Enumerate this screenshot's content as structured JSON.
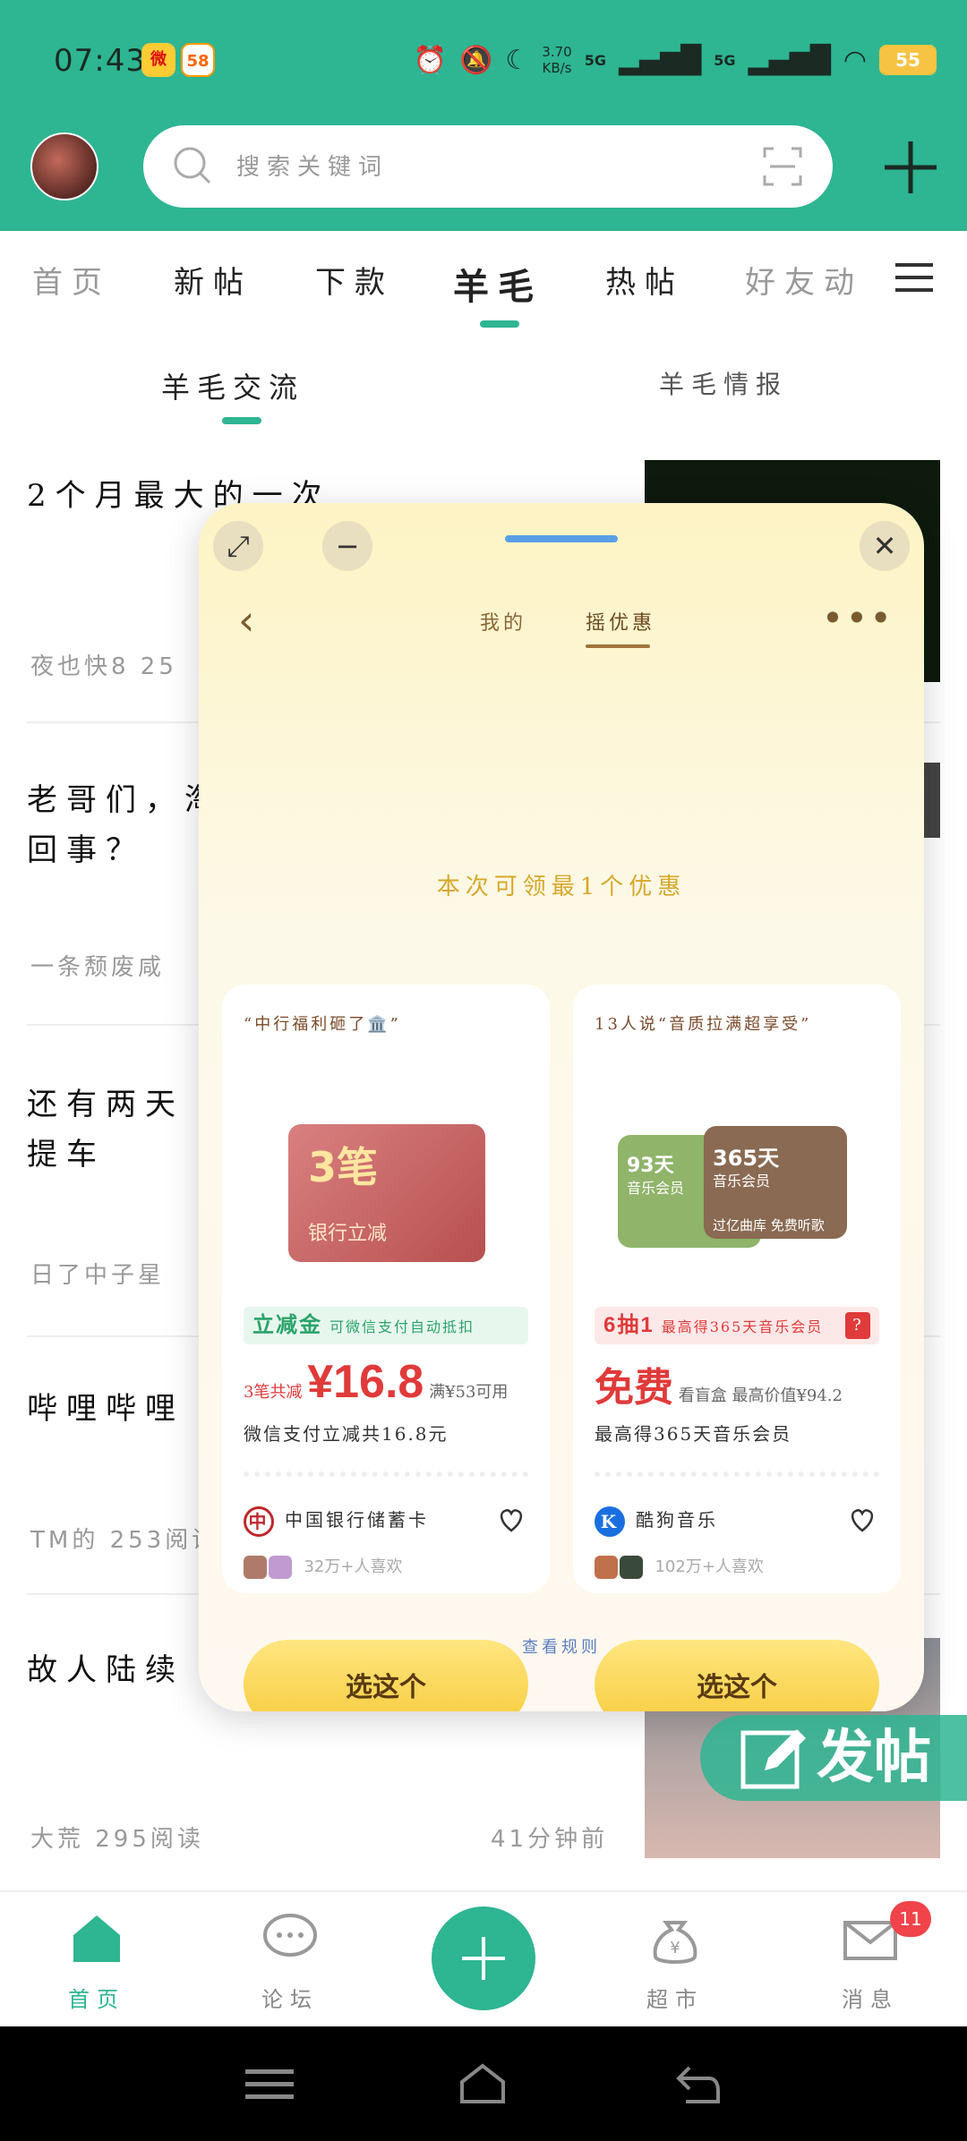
{
  "status": {
    "time": "07:43",
    "apps": [
      "微",
      "58"
    ],
    "speed": "3.70\nKB/s",
    "signal1": "5G",
    "signal2": "5G",
    "battery": "55"
  },
  "header": {
    "search_placeholder": "搜索关键词"
  },
  "nav_tabs": [
    {
      "label": "首页",
      "dim": true
    },
    {
      "label": "新帖"
    },
    {
      "label": "下款"
    },
    {
      "label": "羊毛",
      "active": true
    },
    {
      "label": "热帖"
    },
    {
      "label": "好友动"
    }
  ],
  "sub_tabs": [
    {
      "label": "羊毛交流",
      "active": true
    },
    {
      "label": "羊毛情报"
    }
  ],
  "feed": [
    {
      "title": "2个月最大的一次",
      "meta": "夜也快8   25"
    },
    {
      "title": "老哥们，淘",
      "title2": "回事？",
      "meta": "一条颓废咸"
    },
    {
      "title": "还有两天",
      "title2": "提车",
      "meta": "日了中子星"
    },
    {
      "title": "哔哩哔哩",
      "meta": "TM的 253阅读"
    },
    {
      "title": "故人陆续",
      "meta": "大荒 295阅读",
      "meta_right": "41分钟前"
    }
  ],
  "popup": {
    "tabs": [
      "我的",
      "摇优惠"
    ],
    "headline": "本次可领最1个优惠",
    "rules": "查看规则",
    "cards": [
      {
        "tag": "“中行福利砸了🏛️”",
        "visual_big": "3笔",
        "visual_small": "银行立减",
        "promo_strong": "立减金",
        "promo_text": "可微信支付自动抵扣",
        "price_prefix": "3笔共减",
        "price": "¥16.8",
        "price_suffix": "满¥53可用",
        "sub": "微信支付立减共16.8元",
        "brand": "中国银行储蓄卡",
        "likes": "32万+人喜欢",
        "button": "选这个"
      },
      {
        "tag": "13人说“音质拉满超享受”",
        "visual_big": "93天",
        "visual_small": "过亿曲库 免费听歌",
        "visual_big2": "365天",
        "visual_label": "音乐会员",
        "promo_strong": "6抽1",
        "promo_text": "最高得365天音乐会员",
        "price_prefix": "免费",
        "price": "",
        "price_suffix": "看盲盒 最高价值¥94.2",
        "sub": "最高得365天音乐会员",
        "brand": "酷狗音乐",
        "likes": "102万+人喜欢",
        "button": "选这个"
      }
    ]
  },
  "fab": {
    "label": "发帖"
  },
  "bottom_nav": [
    {
      "label": "首页",
      "active": true
    },
    {
      "label": "论坛"
    },
    {
      "label": ""
    },
    {
      "label": "超市"
    },
    {
      "label": "消息",
      "badge": "11"
    }
  ],
  "colors": {
    "brand": "#2eb592",
    "accent_red": "#e03a3a",
    "gold": "#d6a82a"
  }
}
